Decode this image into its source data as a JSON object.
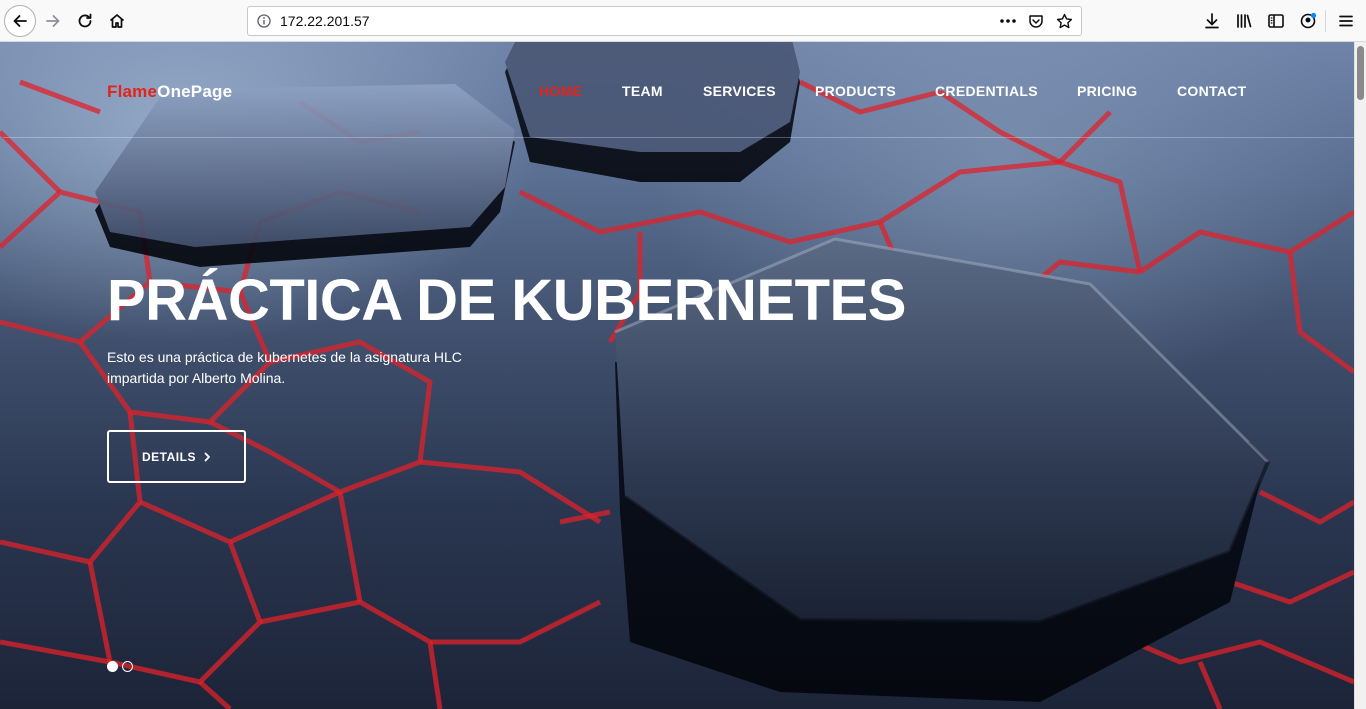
{
  "browser": {
    "url": "172.22.201.57",
    "icons": [
      "back-icon",
      "forward-icon",
      "reload-icon",
      "home-icon",
      "info-icon",
      "more-icon",
      "pocket-icon",
      "star-icon",
      "download-icon",
      "library-icon",
      "sidebar-icon",
      "account-icon",
      "menu-icon"
    ]
  },
  "site": {
    "logo_part1": "Flame",
    "logo_part2": "OnePage",
    "nav": [
      {
        "label": "HOME",
        "active": true
      },
      {
        "label": "TEAM",
        "active": false
      },
      {
        "label": "SERVICES",
        "active": false
      },
      {
        "label": "PRODUCTS",
        "active": false
      },
      {
        "label": "CREDENTIALS",
        "active": false
      },
      {
        "label": "PRICING",
        "active": false
      },
      {
        "label": "CONTACT",
        "active": false
      }
    ]
  },
  "hero": {
    "title": "PRÁCTICA DE KUBERNETES",
    "description": "Esto es una práctica de kubernetes de la asignatura HLC impartida por Alberto Molina.",
    "button_label": "DETAILS",
    "slides": [
      {
        "active": true
      },
      {
        "active": false
      }
    ]
  },
  "colors": {
    "accent": "#e1251b",
    "text": "#ffffff",
    "toolbar_bg": "#f9f9fa"
  }
}
